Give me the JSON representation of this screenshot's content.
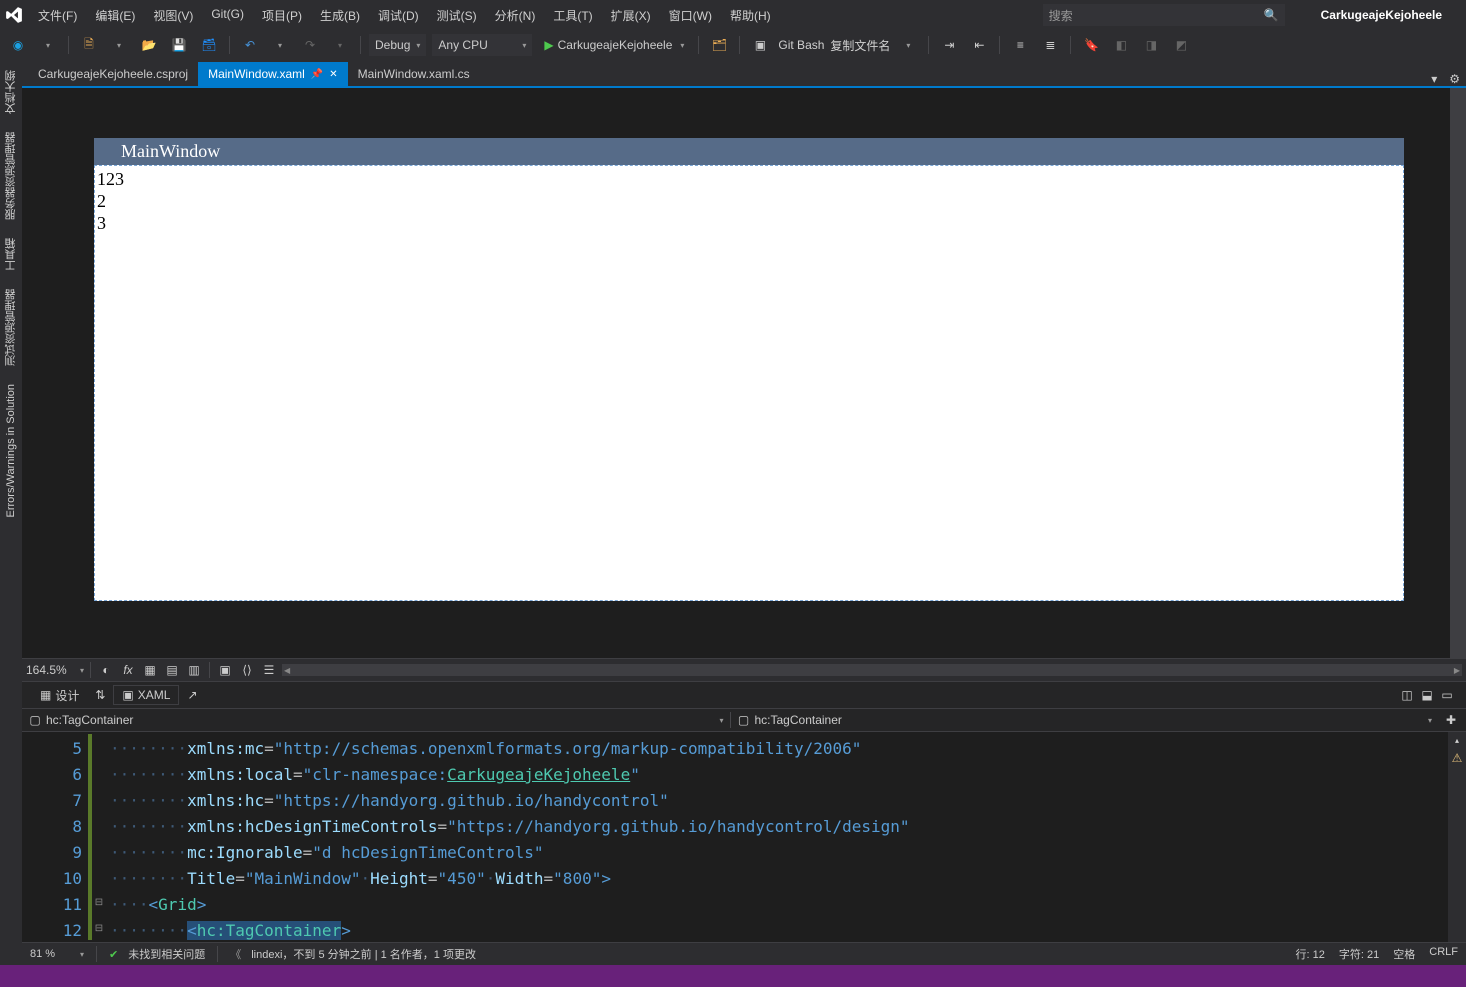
{
  "title_bar": {
    "app_title": "CarkugeajeKejoheele",
    "search_placeholder": "搜索",
    "menus": [
      "文件(F)",
      "编辑(E)",
      "视图(V)",
      "Git(G)",
      "项目(P)",
      "生成(B)",
      "调试(D)",
      "测试(S)",
      "分析(N)",
      "工具(T)",
      "扩展(X)",
      "窗口(W)",
      "帮助(H)"
    ]
  },
  "toolbar": {
    "config": "Debug",
    "platform": "Any CPU",
    "run_target": "CarkugeajeKejoheele",
    "git_bash": "Git Bash",
    "file_op": "复制文件名"
  },
  "left_rail": [
    "文档大纲",
    "服务器资源管理器",
    "工具箱",
    "测试资源管理器",
    "Errors/Warnings in Solution"
  ],
  "tabs": {
    "t0": "CarkugeajeKejoheele.csproj",
    "t1": "MainWindow.xaml",
    "t2": "MainWindow.xaml.cs"
  },
  "preview": {
    "title": "MainWindow",
    "l1": "123",
    "l2": "2",
    "l3": "3"
  },
  "designer_toolbar": {
    "zoom": "164.5%"
  },
  "split_bar": {
    "design": "设计",
    "xaml": "XAML"
  },
  "breadcrumb": {
    "left": "hc:TagContainer",
    "right": "hc:TagContainer"
  },
  "code": {
    "line_nums": [
      "5",
      "6",
      "7",
      "8",
      "9",
      "10",
      "11",
      "12"
    ],
    "dots8": "········",
    "dots4": "····",
    "dots8b": "········",
    "ns_mc_attr": "xmlns:mc",
    "ns_mc_val": "\"http://schemas.openxmlformats.org/markup-compatibility/2006\"",
    "ns_local_attr": "xmlns:local",
    "ns_local_pre": "\"clr-namespace:",
    "ns_local_link": "CarkugeajeKejoheele",
    "ns_local_post": "\"",
    "ns_hc_attr": "xmlns:hc",
    "ns_hc_val": "\"https://handyorg.github.io/handycontrol\"",
    "ns_hcd_attr": "xmlns:hcDesignTimeControls",
    "ns_hcd_val": "\"https://handyorg.github.io/handycontrol/design\"",
    "ign_attr": "mc:Ignorable",
    "ign_val": "\"d hcDesignTimeControls\"",
    "title_attr": "Title",
    "title_val": "\"MainWindow\"",
    "height_attr": "Height",
    "height_val": "\"450\"",
    "width_attr": "Width",
    "width_val": "\"800\"",
    "grid_open_lt": "<",
    "grid_name": "Grid",
    "grid_open_gt": ">",
    "tag_open_lt": "<",
    "tag_name": "hc:TagContainer",
    "tag_open_gt": ">"
  },
  "bottom_info": {
    "pct": "81 %",
    "issues": "未找到相关问题",
    "blame": "lindexi，不到 5 分钟之前 | 1 名作者，1 项更改"
  },
  "status": {
    "line": "行: 12",
    "col": "字符: 21",
    "spaces": "空格",
    "ending": "CRLF"
  }
}
